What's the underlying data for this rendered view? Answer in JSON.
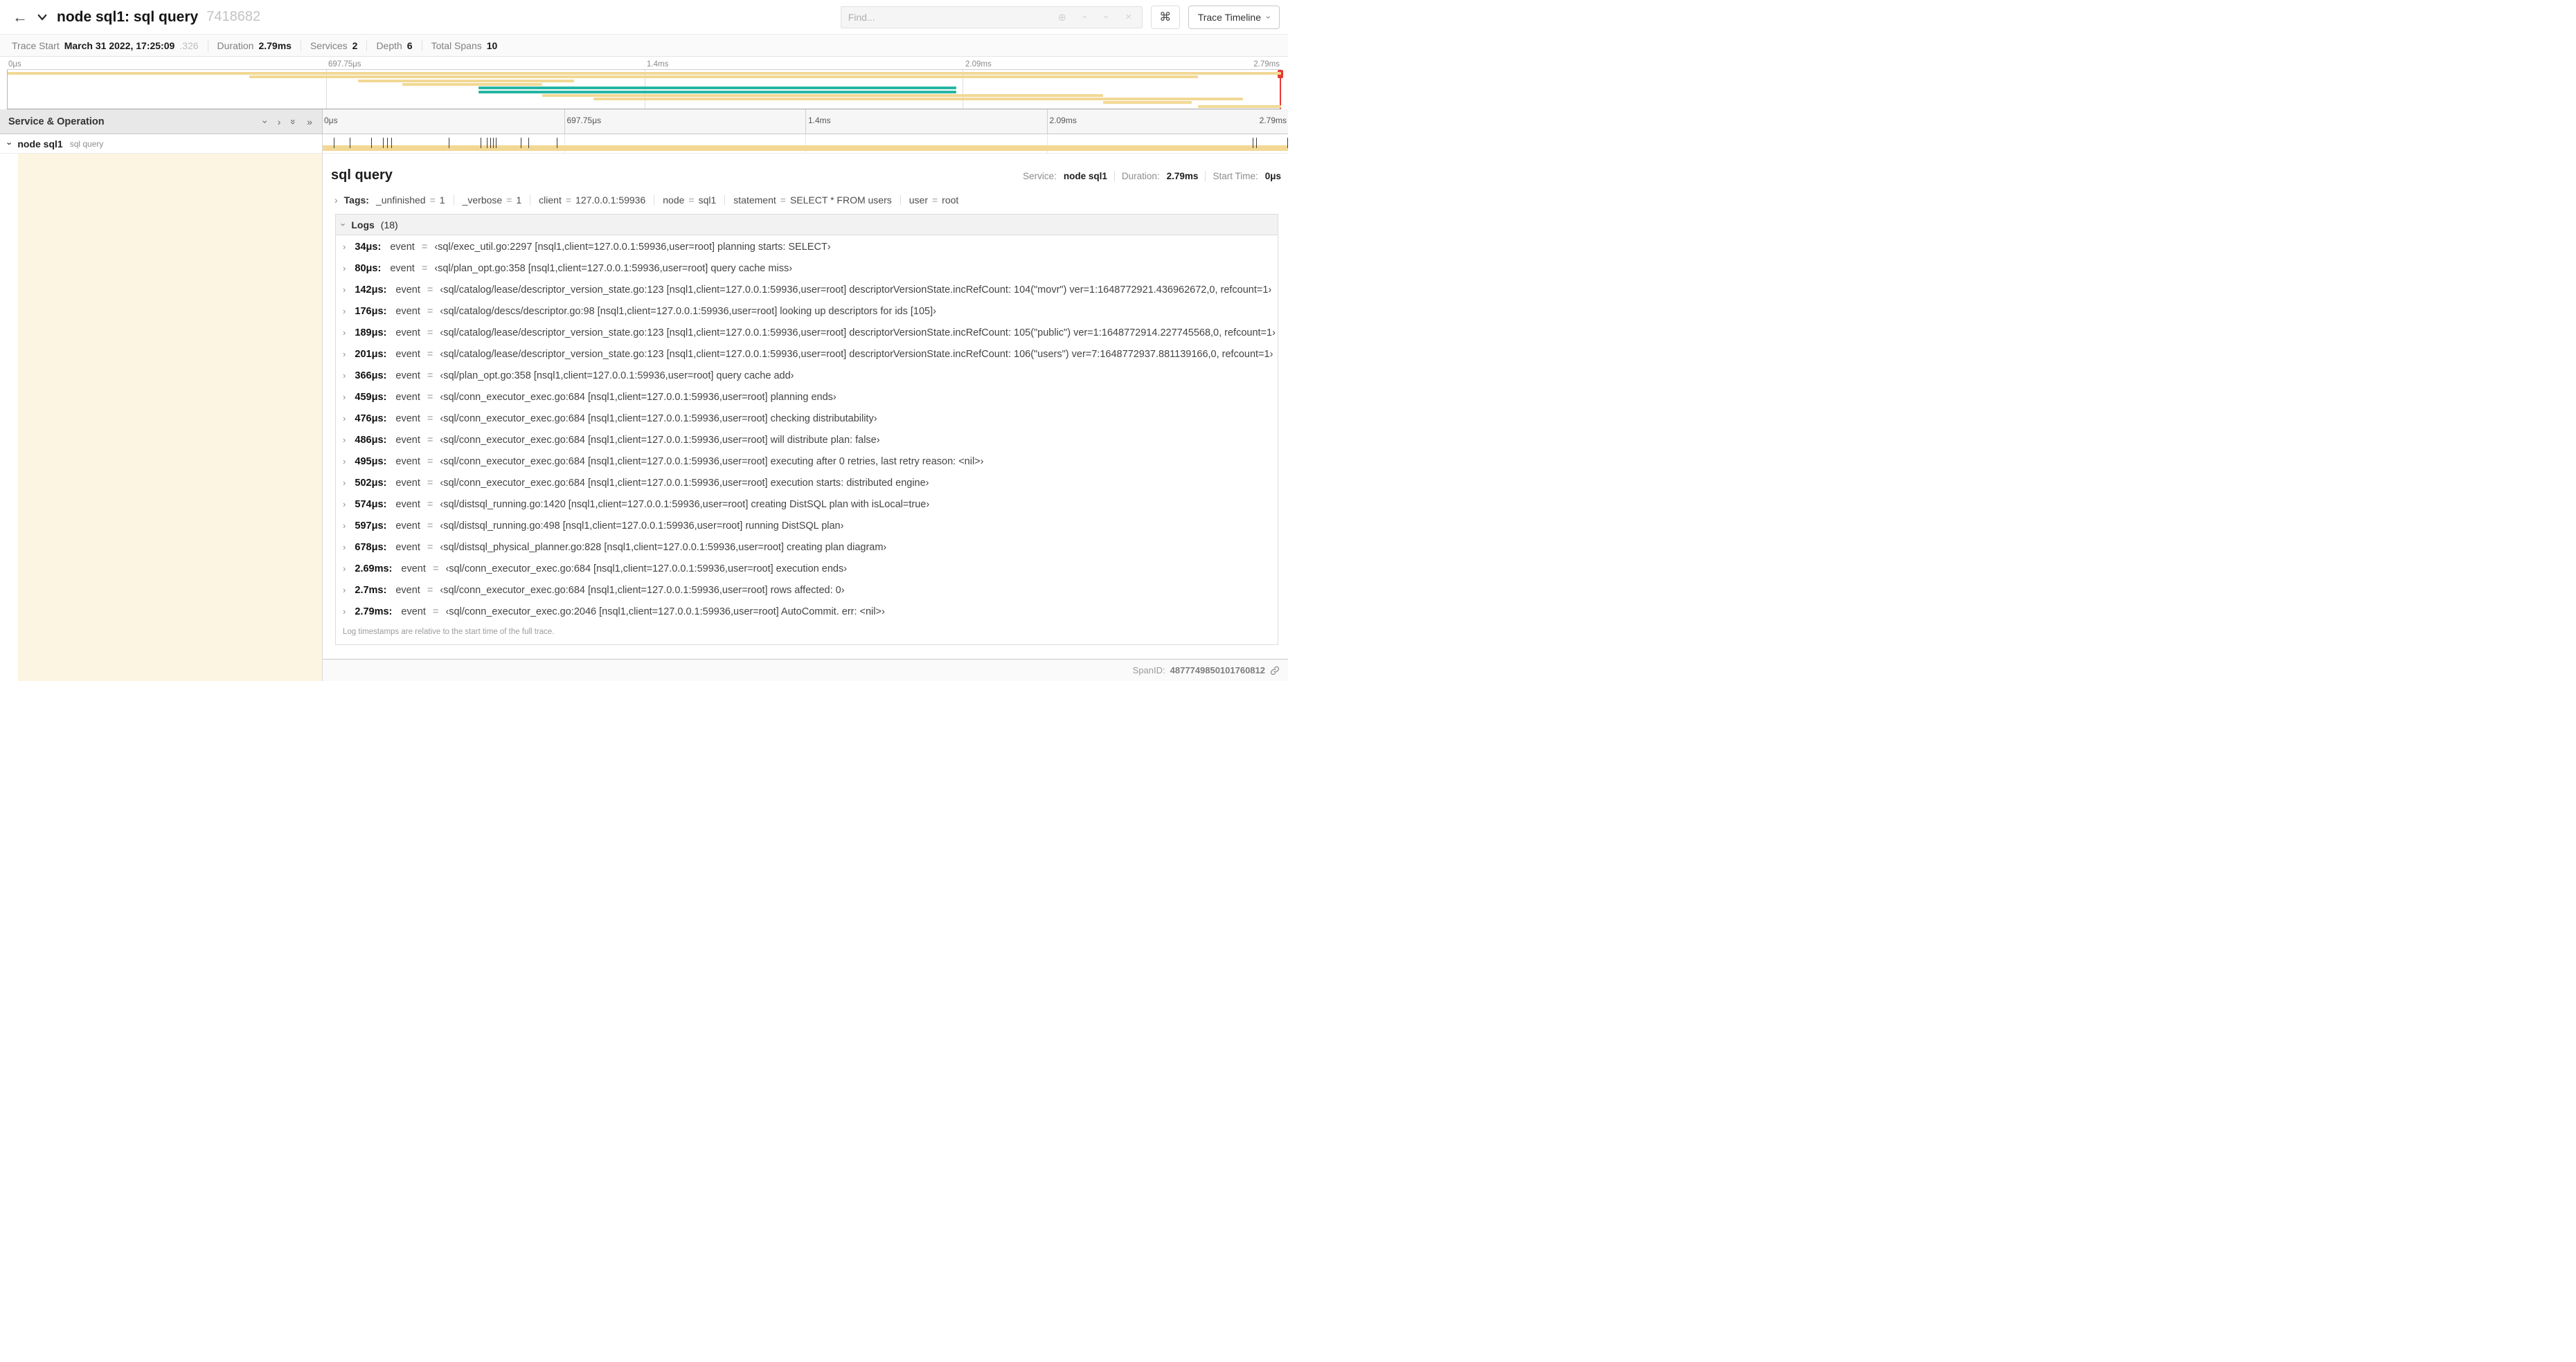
{
  "colors": {
    "tan": "#F2D894",
    "teal": "#25B6A4",
    "scrubber": "#E53935",
    "cream": "#FBF5E1"
  },
  "header": {
    "back_icon": "←",
    "title": "node sql1: sql query",
    "trace_id": "7418682",
    "find_placeholder": "Find...",
    "kbd_label": "⌘",
    "view_button_label": "Trace Timeline"
  },
  "summary": {
    "trace_start_label": "Trace Start",
    "trace_start_value": "March 31 2022, 17:25:09",
    "trace_start_frac": ".326",
    "duration_label": "Duration",
    "duration_value": "2.79ms",
    "services_label": "Services",
    "services_value": "2",
    "depth_label": "Depth",
    "depth_value": "6",
    "total_spans_label": "Total Spans",
    "total_spans_value": "10"
  },
  "minimap": {
    "tick_labels": [
      "0μs",
      "697.75μs",
      "1.4ms",
      "2.09ms",
      "2.79ms"
    ],
    "spans": [
      {
        "start_pct": 0,
        "end_pct": 100,
        "color": "tan"
      },
      {
        "start_pct": 19,
        "end_pct": 93.5,
        "color": "tan"
      },
      {
        "start_pct": 27.5,
        "end_pct": 44.5,
        "color": "tan"
      },
      {
        "start_pct": 31,
        "end_pct": 42,
        "color": "tan"
      },
      {
        "start_pct": 37,
        "end_pct": 74.5,
        "color": "teal"
      },
      {
        "start_pct": 37,
        "end_pct": 74.5,
        "color": "teal"
      },
      {
        "start_pct": 42,
        "end_pct": 86,
        "color": "tan"
      },
      {
        "start_pct": 46,
        "end_pct": 97,
        "color": "tan"
      },
      {
        "start_pct": 86,
        "end_pct": 93,
        "color": "tan"
      },
      {
        "start_pct": 93.5,
        "end_pct": 100,
        "color": "tan"
      }
    ]
  },
  "timeline": {
    "left_header_title": "Service & Operation",
    "tick_labels": [
      "0μs",
      "697.75μs",
      "1.4ms",
      "2.09ms",
      "2.79ms"
    ]
  },
  "span_row": {
    "service": "node sql1",
    "operation": "sql query",
    "duration_us": 2790,
    "tick_times_us": [
      34,
      80,
      142,
      176,
      189,
      201,
      366,
      459,
      476,
      486,
      495,
      502,
      574,
      597,
      678,
      2690,
      2700,
      2790
    ]
  },
  "detail": {
    "title": "sql query",
    "service_label": "Service:",
    "service_value": "node sql1",
    "duration_label": "Duration:",
    "duration_value": "2.79ms",
    "start_time_label": "Start Time:",
    "start_time_value": "0μs",
    "tags_label": "Tags:",
    "eq": "=",
    "tags": [
      {
        "key": "_unfinished",
        "value": "1"
      },
      {
        "key": "_verbose",
        "value": "1"
      },
      {
        "key": "client",
        "value": "127.0.0.1:59936"
      },
      {
        "key": "node",
        "value": "sql1"
      },
      {
        "key": "statement",
        "value": "SELECT * FROM users"
      },
      {
        "key": "user",
        "value": "root"
      }
    ],
    "logs_label": "Logs",
    "logs_count": "(18)",
    "log_key": "event",
    "logs": [
      {
        "time": "34μs:",
        "value": "‹sql/exec_util.go:2297 [nsql1,client=127.0.0.1:59936,user=root] planning starts: SELECT›"
      },
      {
        "time": "80μs:",
        "value": "‹sql/plan_opt.go:358 [nsql1,client=127.0.0.1:59936,user=root] query cache miss›"
      },
      {
        "time": "142μs:",
        "value": "‹sql/catalog/lease/descriptor_version_state.go:123 [nsql1,client=127.0.0.1:59936,user=root] descriptorVersionState.incRefCount: 104(\"movr\") ver=1:1648772921.436962672,0, refcount=1›"
      },
      {
        "time": "176μs:",
        "value": "‹sql/catalog/descs/descriptor.go:98 [nsql1,client=127.0.0.1:59936,user=root] looking up descriptors for ids [105]›"
      },
      {
        "time": "189μs:",
        "value": "‹sql/catalog/lease/descriptor_version_state.go:123 [nsql1,client=127.0.0.1:59936,user=root] descriptorVersionState.incRefCount: 105(\"public\") ver=1:1648772914.227745568,0, refcount=1›"
      },
      {
        "time": "201μs:",
        "value": "‹sql/catalog/lease/descriptor_version_state.go:123 [nsql1,client=127.0.0.1:59936,user=root] descriptorVersionState.incRefCount: 106(\"users\") ver=7:1648772937.881139166,0, refcount=1›"
      },
      {
        "time": "366μs:",
        "value": "‹sql/plan_opt.go:358 [nsql1,client=127.0.0.1:59936,user=root] query cache add›"
      },
      {
        "time": "459μs:",
        "value": "‹sql/conn_executor_exec.go:684 [nsql1,client=127.0.0.1:59936,user=root] planning ends›"
      },
      {
        "time": "476μs:",
        "value": "‹sql/conn_executor_exec.go:684 [nsql1,client=127.0.0.1:59936,user=root] checking distributability›"
      },
      {
        "time": "486μs:",
        "value": "‹sql/conn_executor_exec.go:684 [nsql1,client=127.0.0.1:59936,user=root] will distribute plan: false›"
      },
      {
        "time": "495μs:",
        "value": "‹sql/conn_executor_exec.go:684 [nsql1,client=127.0.0.1:59936,user=root] executing after 0 retries, last retry reason: <nil>›"
      },
      {
        "time": "502μs:",
        "value": "‹sql/conn_executor_exec.go:684 [nsql1,client=127.0.0.1:59936,user=root] execution starts: distributed engine›"
      },
      {
        "time": "574μs:",
        "value": "‹sql/distsql_running.go:1420 [nsql1,client=127.0.0.1:59936,user=root] creating DistSQL plan with isLocal=true›"
      },
      {
        "time": "597μs:",
        "value": "‹sql/distsql_running.go:498 [nsql1,client=127.0.0.1:59936,user=root] running DistSQL plan›"
      },
      {
        "time": "678μs:",
        "value": "‹sql/distsql_physical_planner.go:828 [nsql1,client=127.0.0.1:59936,user=root] creating plan diagram›"
      },
      {
        "time": "2.69ms:",
        "value": "‹sql/conn_executor_exec.go:684 [nsql1,client=127.0.0.1:59936,user=root] execution ends›"
      },
      {
        "time": "2.7ms:",
        "value": "‹sql/conn_executor_exec.go:684 [nsql1,client=127.0.0.1:59936,user=root] rows affected: 0›"
      },
      {
        "time": "2.79ms:",
        "value": "‹sql/conn_executor_exec.go:2046 [nsql1,client=127.0.0.1:59936,user=root] AutoCommit. err: <nil>›"
      }
    ],
    "logs_footnote": "Log timestamps are relative to the start time of the full trace.",
    "span_id_label": "SpanID:",
    "span_id_value": "4877749850101760812"
  }
}
